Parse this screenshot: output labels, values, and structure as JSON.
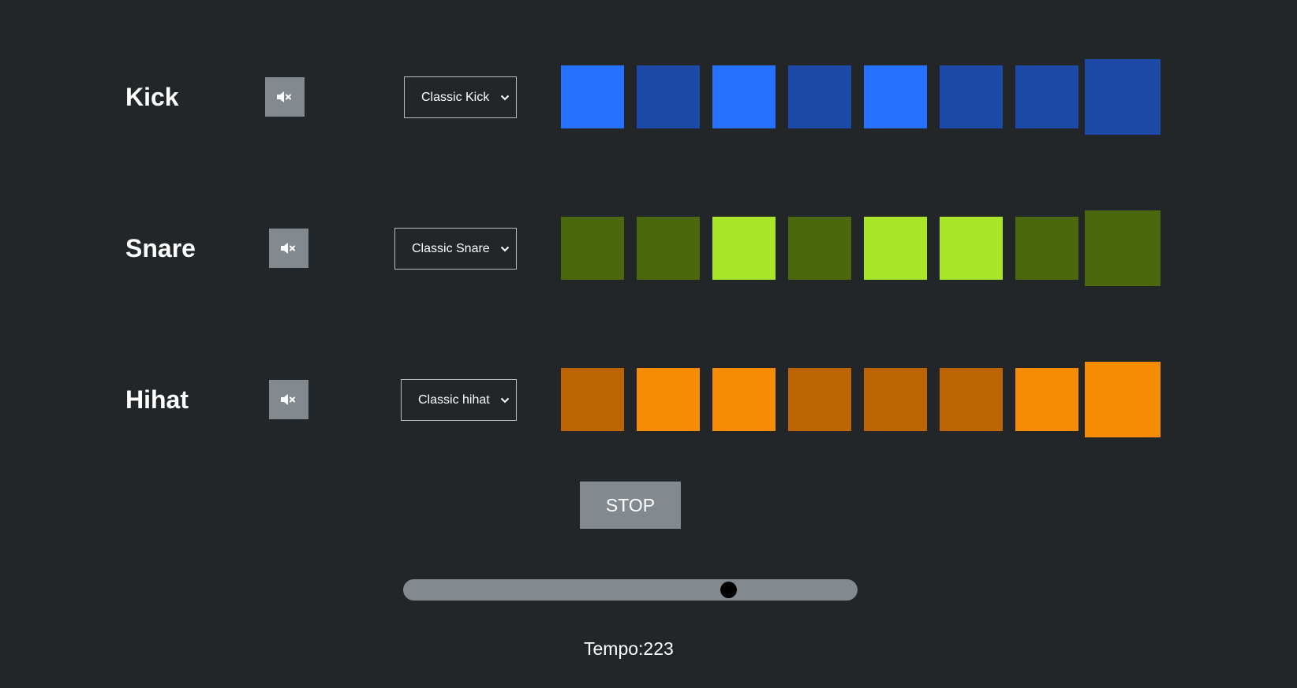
{
  "tracks": [
    {
      "name": "Kick",
      "mute_icon": "speaker-muted-icon",
      "sample": "Classic Kick",
      "color_on": "#2672ff",
      "color_off": "#1c4aa6",
      "pads": [
        true,
        false,
        true,
        false,
        true,
        false,
        false,
        false
      ]
    },
    {
      "name": "Snare",
      "mute_icon": "speaker-muted-icon",
      "sample": "Classic Snare",
      "color_on": "#a8e627",
      "color_off": "#4b690c",
      "pads": [
        false,
        false,
        true,
        false,
        true,
        true,
        false,
        false
      ]
    },
    {
      "name": "Hihat",
      "mute_icon": "speaker-muted-icon",
      "sample": "Classic hihat",
      "color_on": "#f68c04",
      "color_off": "#ba6402",
      "pads": [
        false,
        true,
        true,
        false,
        false,
        false,
        true,
        true
      ]
    }
  ],
  "current_step": 8,
  "controls": {
    "stop_label": "STOP",
    "tempo_label": "Tempo:223",
    "tempo_slider_fraction": 0.715
  }
}
